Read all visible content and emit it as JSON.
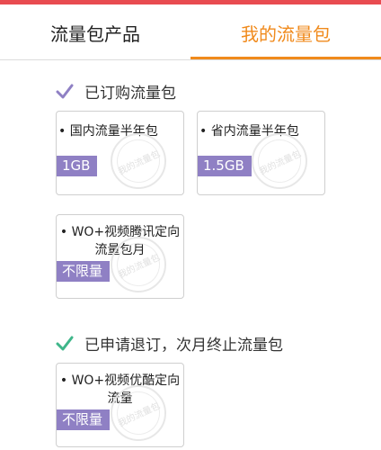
{
  "tabs": {
    "products_label": "流量包产品",
    "my_packs_label": "我的流量包"
  },
  "sections": {
    "purchased": {
      "title": "已订购流量包",
      "icon": "checkmark-icon",
      "icon_color": "#8f80c4"
    },
    "unsubscribed": {
      "title": "已申请退订，次月终止流量包",
      "icon": "checkmark-icon",
      "icon_color": "#3fb68a"
    }
  },
  "cards": {
    "domestic_half_year": {
      "title": "国内流量半年包",
      "badge": "1GB",
      "stamp": "我的流量包"
    },
    "province_half_year": {
      "title": "省内流量半年包",
      "badge": "1.5GB",
      "stamp": "我的流量包"
    },
    "wo_tencent": {
      "title": "WO+视频腾讯定向\n流量包月",
      "badge": "不限量",
      "stamp": "我的流量包"
    },
    "wo_youku": {
      "title": "WO+视频优酷定向\n流量",
      "badge": "不限量",
      "stamp": "我的流量包"
    }
  },
  "colors": {
    "top_strip": "#e84b50",
    "active_tab": "#f08a1c",
    "badge": "#8f80c4"
  }
}
